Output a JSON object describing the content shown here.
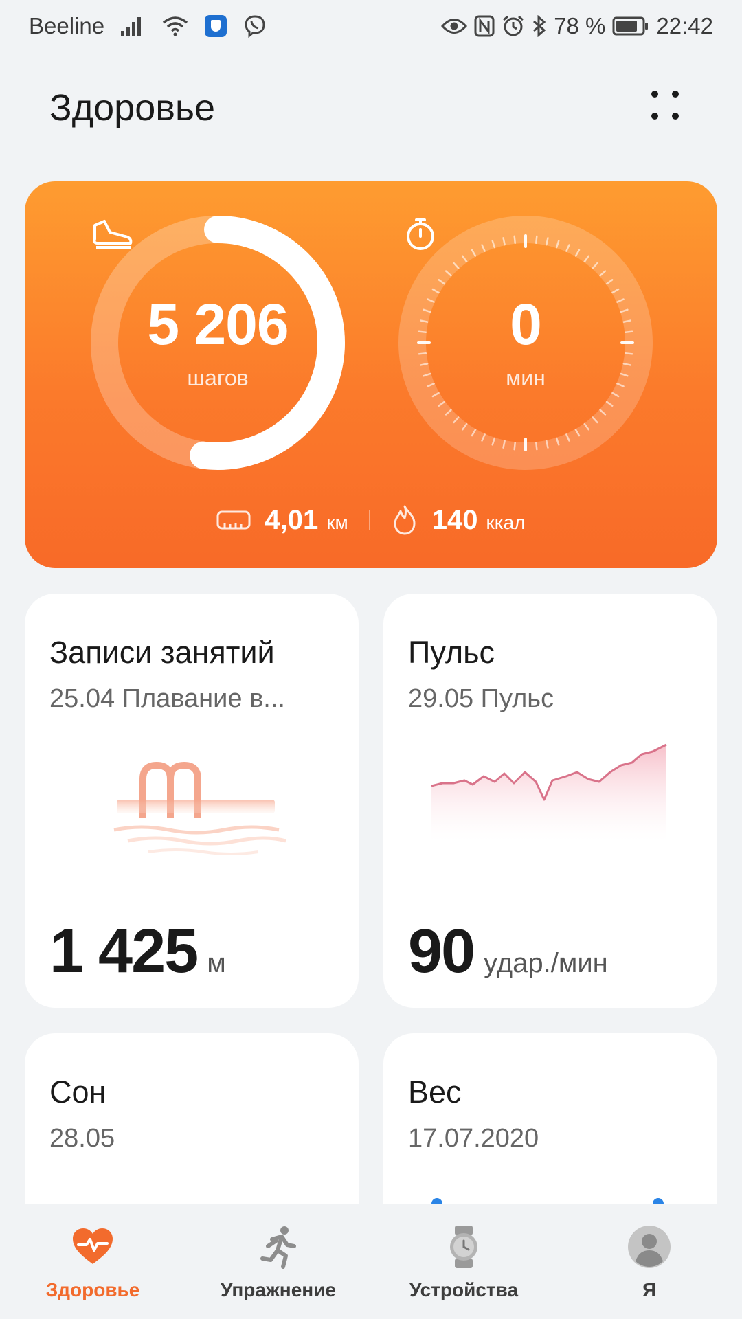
{
  "status_bar": {
    "carrier": "Beeline",
    "battery": "78 %",
    "time": "22:42"
  },
  "header": {
    "title": "Здоровье"
  },
  "activity": {
    "steps_value": "5 206",
    "steps_unit": "шагов",
    "steps_goal_fraction": 0.52,
    "time_value": "0",
    "time_unit": "мин",
    "distance_value": "4,01",
    "distance_unit": "км",
    "calories_value": "140",
    "calories_unit": "ккал"
  },
  "tiles": {
    "workouts": {
      "title": "Записи занятий",
      "subtitle": "25.04 Плавание в...",
      "value": "1 425",
      "unit": "м"
    },
    "pulse": {
      "title": "Пульс",
      "subtitle": "29.05 Пульс",
      "value": "90",
      "unit": "удар./мин"
    },
    "sleep": {
      "title": "Сон",
      "subtitle": "28.05"
    },
    "weight": {
      "title": "Вес",
      "subtitle": "17.07.2020"
    }
  },
  "nav": {
    "items": [
      {
        "label": "Здоровье",
        "icon": "heart-pulse-icon",
        "active": true
      },
      {
        "label": "Упражнение",
        "icon": "running-icon",
        "active": false
      },
      {
        "label": "Устройства",
        "icon": "watch-icon",
        "active": false
      },
      {
        "label": "Я",
        "icon": "profile-icon",
        "active": false
      }
    ]
  },
  "colors": {
    "accent": "#f26b2d",
    "card_top": "#fe9c30",
    "card_bottom": "#f86a28",
    "pulse_line": "#e07a8c"
  }
}
